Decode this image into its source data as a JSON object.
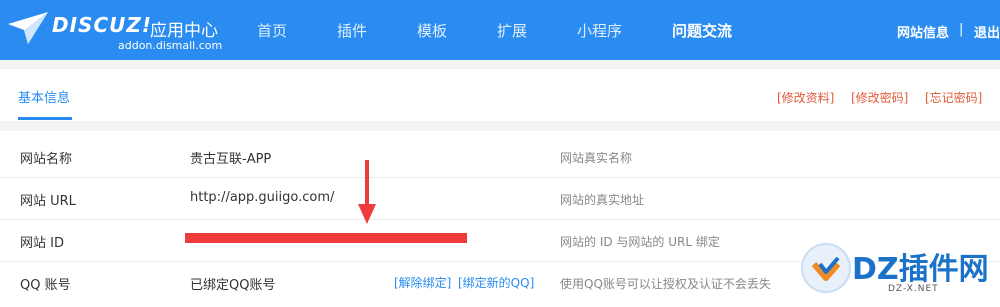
{
  "header": {
    "brand": "DISCUZ!",
    "brand_cn": "应用中心",
    "brand_domain": "addon.dismall.com",
    "nav": [
      "首页",
      "插件",
      "模板",
      "扩展",
      "小程序",
      "问题交流"
    ],
    "active_nav": "问题交流",
    "site_info": "网站信息",
    "separator": "|",
    "logout": "退出"
  },
  "tabs": {
    "basic_info": "基本信息"
  },
  "actions": {
    "edit_profile": "[修改资料]",
    "change_password": "[修改密码]",
    "forgot_password": "[忘记密码]"
  },
  "rows": [
    {
      "label": "网站名称",
      "value": "贵古互联-APP",
      "desc": "网站真实名称"
    },
    {
      "label": "网站 URL",
      "value": "http://app.guiigo.com/",
      "desc": "网站的真实地址"
    },
    {
      "label": "网站 ID",
      "value": "",
      "desc": "网站的 ID 与网站的 URL 绑定"
    },
    {
      "label": "QQ 账号",
      "value": "已绑定QQ账号",
      "desc": "使用QQ账号可以让授权及认证不会丢失"
    }
  ],
  "qq_actions": {
    "unbind": "[解除绑定]",
    "bind_new": "[绑定新的QQ]"
  },
  "watermark": {
    "text": "DZ插件网",
    "url": "DZ-X.NET"
  },
  "colors": {
    "header_bg": "#2a8cf0",
    "accent": "#2a8cf0",
    "action_red": "#e05a3a",
    "redaction": "#ee3b3b"
  }
}
